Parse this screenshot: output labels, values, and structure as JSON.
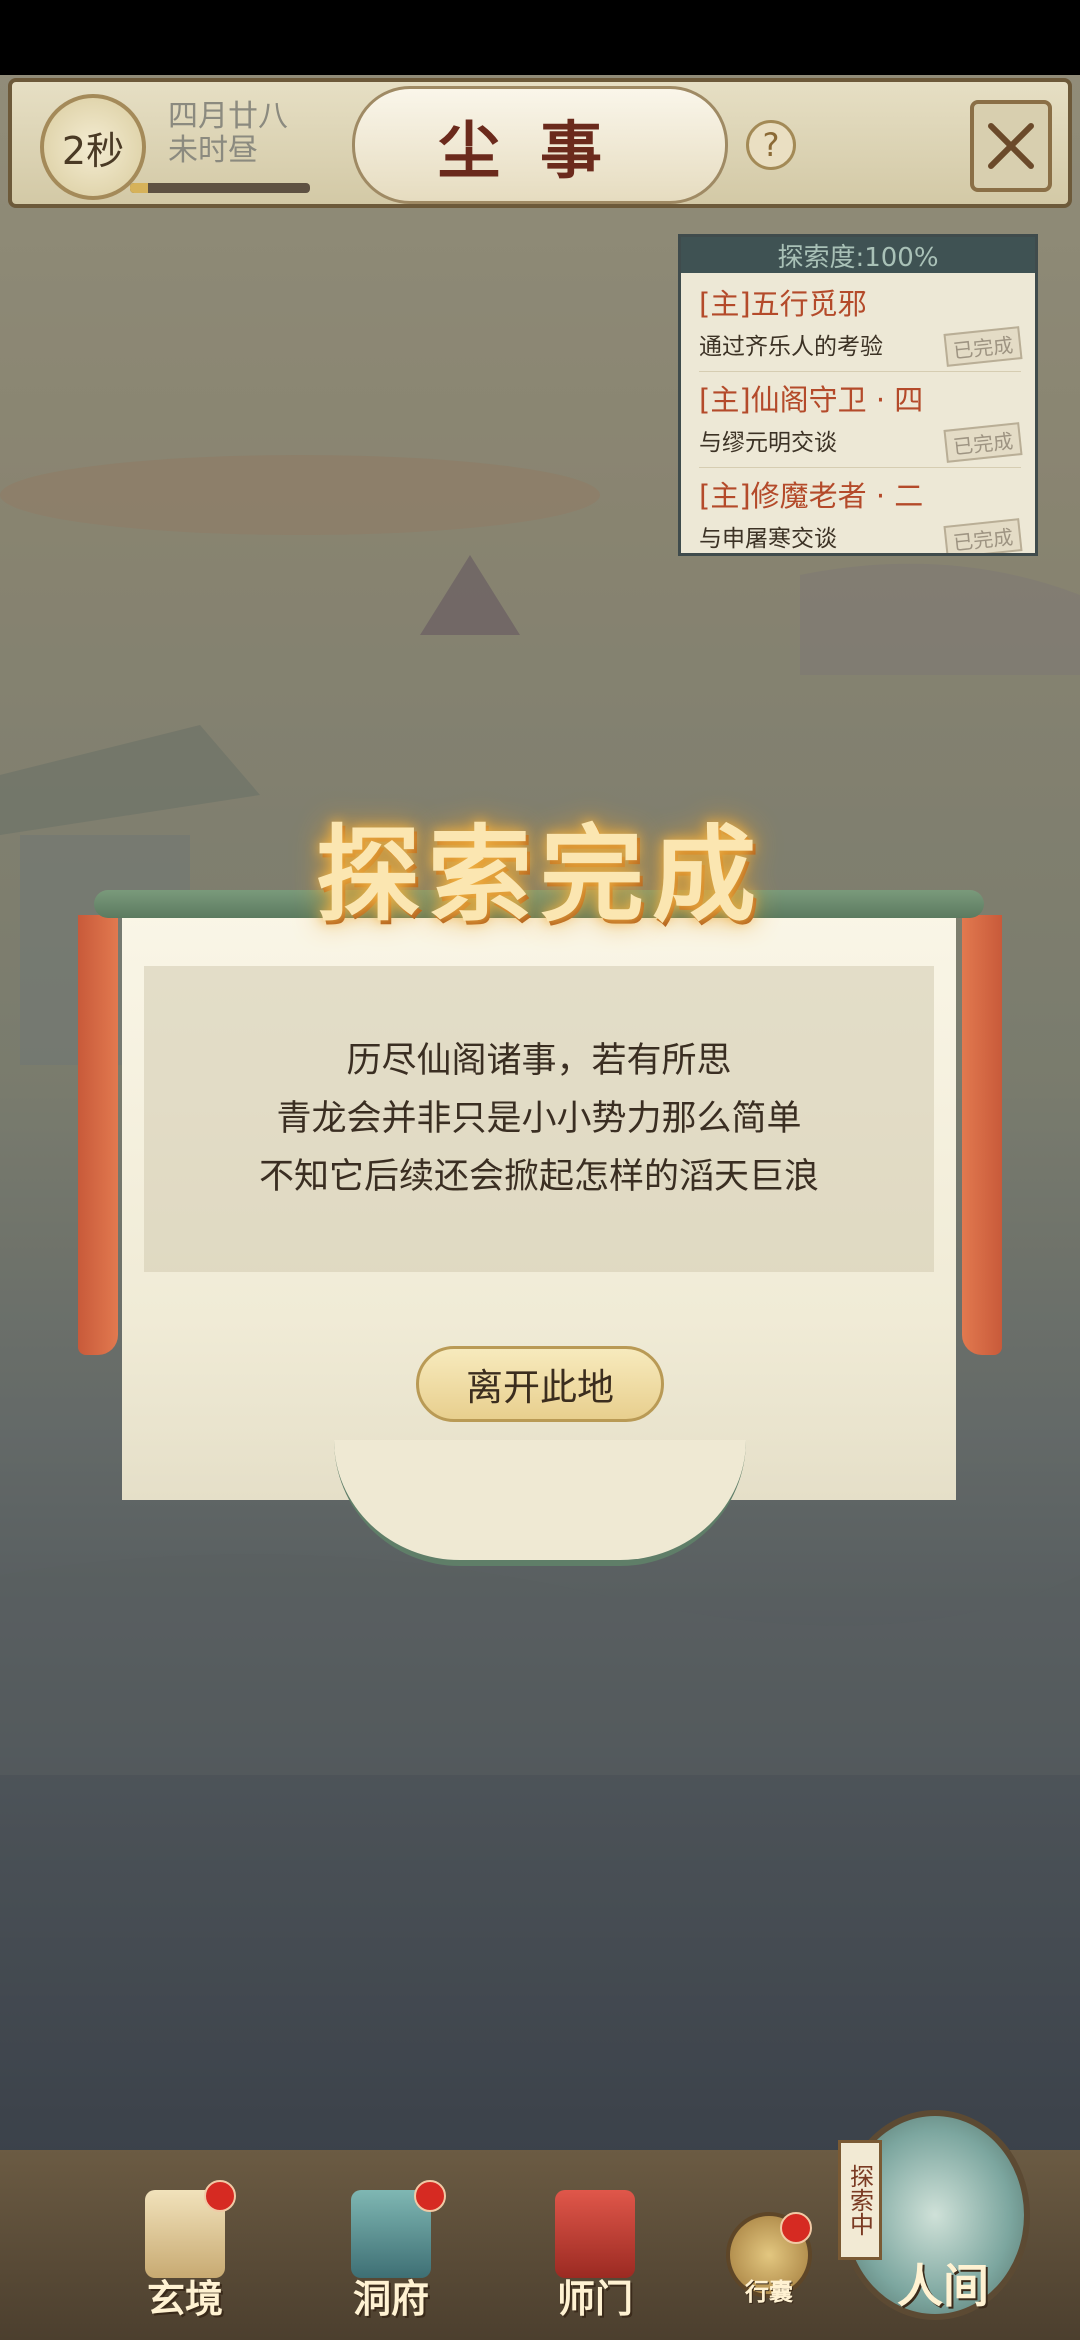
{
  "header": {
    "timer": "2秒",
    "date_line1": "四月廿八",
    "date_line2": "未时昼",
    "title": "尘事",
    "help_label": "?",
    "close_icon": "crossed-swords-icon"
  },
  "quest_panel": {
    "header": "探索度:100%",
    "quests": [
      {
        "title": "[主]五行觅邪",
        "desc": "通过齐乐人的考验",
        "status": "已完成"
      },
      {
        "title": "[主]仙阁守卫 · 四",
        "desc": "与缪元明交谈",
        "status": "已完成"
      },
      {
        "title": "[主]修魔老者 · 二",
        "desc": "与申屠寒交谈",
        "status": "已完成"
      }
    ]
  },
  "modal": {
    "title": "探索完成",
    "lines": [
      "历尽仙阁诸事，若有所思",
      "青龙会并非只是小小势力那么简单",
      "不知它后续还会掀起怎样的滔天巨浪"
    ],
    "button": "离开此地"
  },
  "bottom_nav": {
    "items": [
      {
        "label": "玄境",
        "icon": "scroll-icon",
        "badge": true
      },
      {
        "label": "洞府",
        "icon": "pavilion-icon",
        "badge": true
      },
      {
        "label": "师门",
        "icon": "banner-icon",
        "badge": false
      },
      {
        "label": "行囊",
        "icon": "bag-icon",
        "badge": true
      }
    ],
    "world_label": "人间",
    "explore_tag": "探索中"
  },
  "colors": {
    "accent": "#b44a2a",
    "panel": "#3f5253",
    "gold": "#e8cf8e"
  }
}
